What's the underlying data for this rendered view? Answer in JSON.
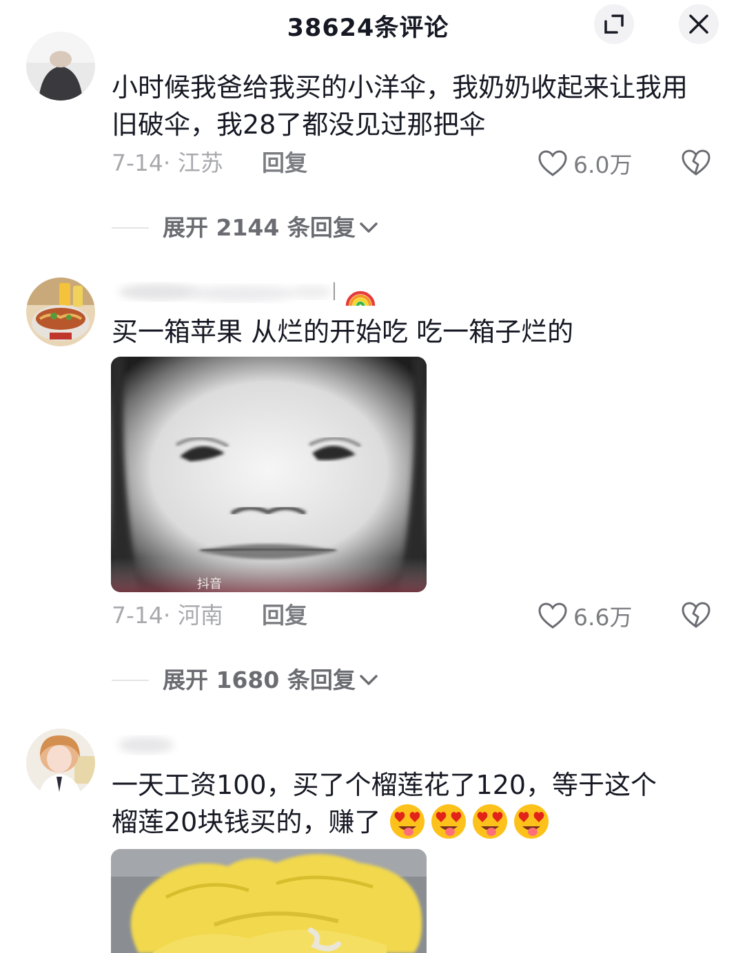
{
  "header": {
    "title": "38624条评论",
    "expand_icon": "collapse-expand-icon",
    "close_icon": "close-icon"
  },
  "comments": [
    {
      "text": "小时候我爸给我买的小洋伞，我奶奶收起来让我用旧破伞，我28了都没见过那把伞",
      "date_location": "7-14· 江苏",
      "reply_label": "回复",
      "likes": "6.0万",
      "expand_label": "展开 2144 条回复"
    },
    {
      "username_emoji": "🌈",
      "text": "买一箱苹果 从烂的开始吃 吃一箱子烂的",
      "image_watermark": "抖音",
      "date_location": "7-14· 河南",
      "reply_label": "回复",
      "likes": "6.6万",
      "expand_label": "展开 1680 条回复"
    },
    {
      "text_line1": "一天工资100，买了个榴莲花了120，等于这个",
      "text_line2": "榴莲20块钱买的，赚了"
    }
  ],
  "colors": {
    "text_primary": "#161823",
    "text_secondary": "#a8a9ad",
    "text_action": "#7c7d82",
    "durian_yellow": "#f3dc5a"
  }
}
